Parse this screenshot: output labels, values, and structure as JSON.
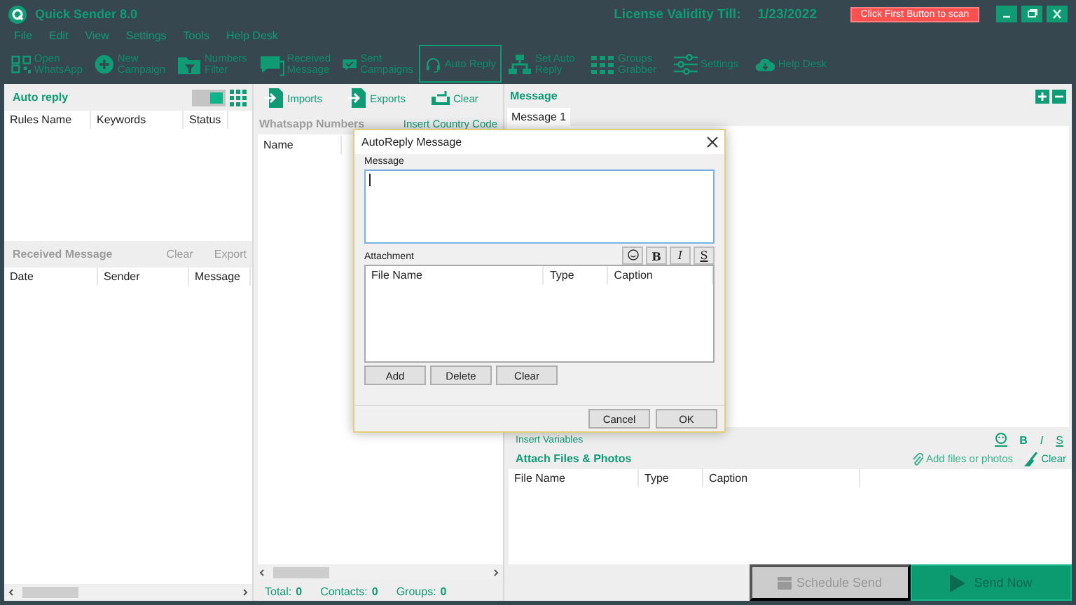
{
  "window": {
    "title": "Quick Sender 8.0",
    "license_label": "License Validity Till:",
    "license_date": "1/23/2022",
    "scan_button": "Click First Button to scan"
  },
  "menu": [
    "File",
    "Edit",
    "View",
    "Settings",
    "Tools",
    "Help Desk"
  ],
  "toolbar": [
    {
      "lines": [
        "Open",
        "WhatsApp"
      ],
      "selected": false
    },
    {
      "lines": [
        "New",
        "Campaign"
      ],
      "selected": false
    },
    {
      "lines": [
        "Numbers",
        "Filter"
      ],
      "selected": false
    },
    {
      "lines": [
        "Received",
        "Message"
      ],
      "selected": false
    },
    {
      "lines": [
        "Sent",
        "Campaigns"
      ],
      "selected": false
    },
    {
      "lines": [
        "Auto Reply"
      ],
      "selected": true
    },
    {
      "lines": [
        "Set Auto",
        "Reply"
      ],
      "selected": false
    },
    {
      "lines": [
        "Groups",
        "Grabber"
      ],
      "selected": false
    },
    {
      "lines": [
        "Settings"
      ],
      "selected": false
    },
    {
      "lines": [
        "Help Desk"
      ],
      "selected": false
    }
  ],
  "left": {
    "auto_reply": {
      "title": "Auto reply",
      "toggle_on": true,
      "columns": [
        "Rules Name",
        "Keywords",
        "Status"
      ]
    },
    "received": {
      "title": "Received Message",
      "disabled": true,
      "actions": [
        {
          "label": "Clear",
          "disabled": true
        },
        {
          "label": "Export",
          "disabled": true
        }
      ],
      "columns": [
        "Date",
        "Sender",
        "Message"
      ]
    }
  },
  "middle": {
    "actions": [
      "Imports",
      "Exports",
      "Clear"
    ],
    "numbers_title": "Whatsapp Numbers",
    "country_code_link": "Insert Country Code",
    "columns": [
      "Name"
    ],
    "stats": [
      {
        "label": "Total:",
        "value": "0"
      },
      {
        "label": "Contacts:",
        "value": "0"
      },
      {
        "label": "Groups:",
        "value": "0"
      }
    ]
  },
  "right": {
    "title": "Message",
    "tabs": [
      {
        "label": "Message 1",
        "selected": true
      }
    ],
    "insert_variables": "Insert Variables",
    "format": [
      "B",
      "I",
      "S"
    ],
    "attach_title": "Attach Files & Photos",
    "add_files": "Add files or photos",
    "clear": "Clear",
    "columns": [
      "File Name",
      "Type",
      "Caption"
    ],
    "schedule": {
      "label": "Schedule Send",
      "disabled": true
    },
    "send": {
      "label": "Send Now"
    }
  },
  "dialog": {
    "title": "AutoReply Message",
    "message_label": "Message",
    "format": [
      "B",
      "I",
      "S"
    ],
    "attachment_label": "Attachment",
    "columns": [
      "File Name",
      "Type",
      "Caption"
    ],
    "actions": [
      "Add",
      "Delete",
      "Clear"
    ],
    "buttons": [
      "Cancel",
      "OK"
    ]
  }
}
